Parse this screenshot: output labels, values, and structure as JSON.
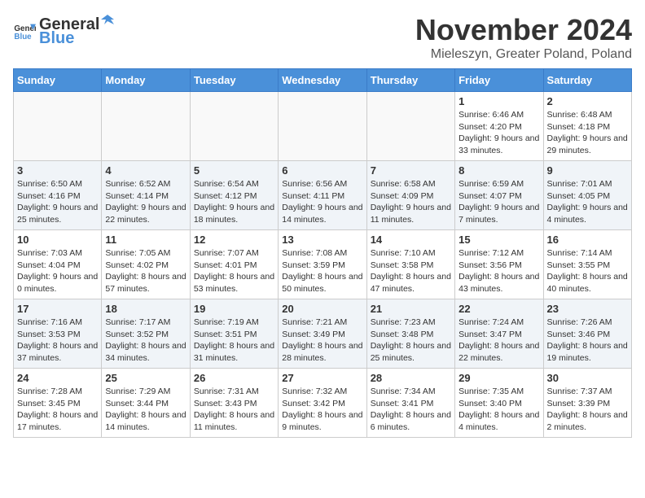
{
  "header": {
    "logo_general": "General",
    "logo_blue": "Blue",
    "month": "November 2024",
    "location": "Mieleszyn, Greater Poland, Poland"
  },
  "weekdays": [
    "Sunday",
    "Monday",
    "Tuesday",
    "Wednesday",
    "Thursday",
    "Friday",
    "Saturday"
  ],
  "weeks": [
    [
      {
        "day": "",
        "info": ""
      },
      {
        "day": "",
        "info": ""
      },
      {
        "day": "",
        "info": ""
      },
      {
        "day": "",
        "info": ""
      },
      {
        "day": "",
        "info": ""
      },
      {
        "day": "1",
        "info": "Sunrise: 6:46 AM\nSunset: 4:20 PM\nDaylight: 9 hours and 33 minutes."
      },
      {
        "day": "2",
        "info": "Sunrise: 6:48 AM\nSunset: 4:18 PM\nDaylight: 9 hours and 29 minutes."
      }
    ],
    [
      {
        "day": "3",
        "info": "Sunrise: 6:50 AM\nSunset: 4:16 PM\nDaylight: 9 hours and 25 minutes."
      },
      {
        "day": "4",
        "info": "Sunrise: 6:52 AM\nSunset: 4:14 PM\nDaylight: 9 hours and 22 minutes."
      },
      {
        "day": "5",
        "info": "Sunrise: 6:54 AM\nSunset: 4:12 PM\nDaylight: 9 hours and 18 minutes."
      },
      {
        "day": "6",
        "info": "Sunrise: 6:56 AM\nSunset: 4:11 PM\nDaylight: 9 hours and 14 minutes."
      },
      {
        "day": "7",
        "info": "Sunrise: 6:58 AM\nSunset: 4:09 PM\nDaylight: 9 hours and 11 minutes."
      },
      {
        "day": "8",
        "info": "Sunrise: 6:59 AM\nSunset: 4:07 PM\nDaylight: 9 hours and 7 minutes."
      },
      {
        "day": "9",
        "info": "Sunrise: 7:01 AM\nSunset: 4:05 PM\nDaylight: 9 hours and 4 minutes."
      }
    ],
    [
      {
        "day": "10",
        "info": "Sunrise: 7:03 AM\nSunset: 4:04 PM\nDaylight: 9 hours and 0 minutes."
      },
      {
        "day": "11",
        "info": "Sunrise: 7:05 AM\nSunset: 4:02 PM\nDaylight: 8 hours and 57 minutes."
      },
      {
        "day": "12",
        "info": "Sunrise: 7:07 AM\nSunset: 4:01 PM\nDaylight: 8 hours and 53 minutes."
      },
      {
        "day": "13",
        "info": "Sunrise: 7:08 AM\nSunset: 3:59 PM\nDaylight: 8 hours and 50 minutes."
      },
      {
        "day": "14",
        "info": "Sunrise: 7:10 AM\nSunset: 3:58 PM\nDaylight: 8 hours and 47 minutes."
      },
      {
        "day": "15",
        "info": "Sunrise: 7:12 AM\nSunset: 3:56 PM\nDaylight: 8 hours and 43 minutes."
      },
      {
        "day": "16",
        "info": "Sunrise: 7:14 AM\nSunset: 3:55 PM\nDaylight: 8 hours and 40 minutes."
      }
    ],
    [
      {
        "day": "17",
        "info": "Sunrise: 7:16 AM\nSunset: 3:53 PM\nDaylight: 8 hours and 37 minutes."
      },
      {
        "day": "18",
        "info": "Sunrise: 7:17 AM\nSunset: 3:52 PM\nDaylight: 8 hours and 34 minutes."
      },
      {
        "day": "19",
        "info": "Sunrise: 7:19 AM\nSunset: 3:51 PM\nDaylight: 8 hours and 31 minutes."
      },
      {
        "day": "20",
        "info": "Sunrise: 7:21 AM\nSunset: 3:49 PM\nDaylight: 8 hours and 28 minutes."
      },
      {
        "day": "21",
        "info": "Sunrise: 7:23 AM\nSunset: 3:48 PM\nDaylight: 8 hours and 25 minutes."
      },
      {
        "day": "22",
        "info": "Sunrise: 7:24 AM\nSunset: 3:47 PM\nDaylight: 8 hours and 22 minutes."
      },
      {
        "day": "23",
        "info": "Sunrise: 7:26 AM\nSunset: 3:46 PM\nDaylight: 8 hours and 19 minutes."
      }
    ],
    [
      {
        "day": "24",
        "info": "Sunrise: 7:28 AM\nSunset: 3:45 PM\nDaylight: 8 hours and 17 minutes."
      },
      {
        "day": "25",
        "info": "Sunrise: 7:29 AM\nSunset: 3:44 PM\nDaylight: 8 hours and 14 minutes."
      },
      {
        "day": "26",
        "info": "Sunrise: 7:31 AM\nSunset: 3:43 PM\nDaylight: 8 hours and 11 minutes."
      },
      {
        "day": "27",
        "info": "Sunrise: 7:32 AM\nSunset: 3:42 PM\nDaylight: 8 hours and 9 minutes."
      },
      {
        "day": "28",
        "info": "Sunrise: 7:34 AM\nSunset: 3:41 PM\nDaylight: 8 hours and 6 minutes."
      },
      {
        "day": "29",
        "info": "Sunrise: 7:35 AM\nSunset: 3:40 PM\nDaylight: 8 hours and 4 minutes."
      },
      {
        "day": "30",
        "info": "Sunrise: 7:37 AM\nSunset: 3:39 PM\nDaylight: 8 hours and 2 minutes."
      }
    ]
  ]
}
